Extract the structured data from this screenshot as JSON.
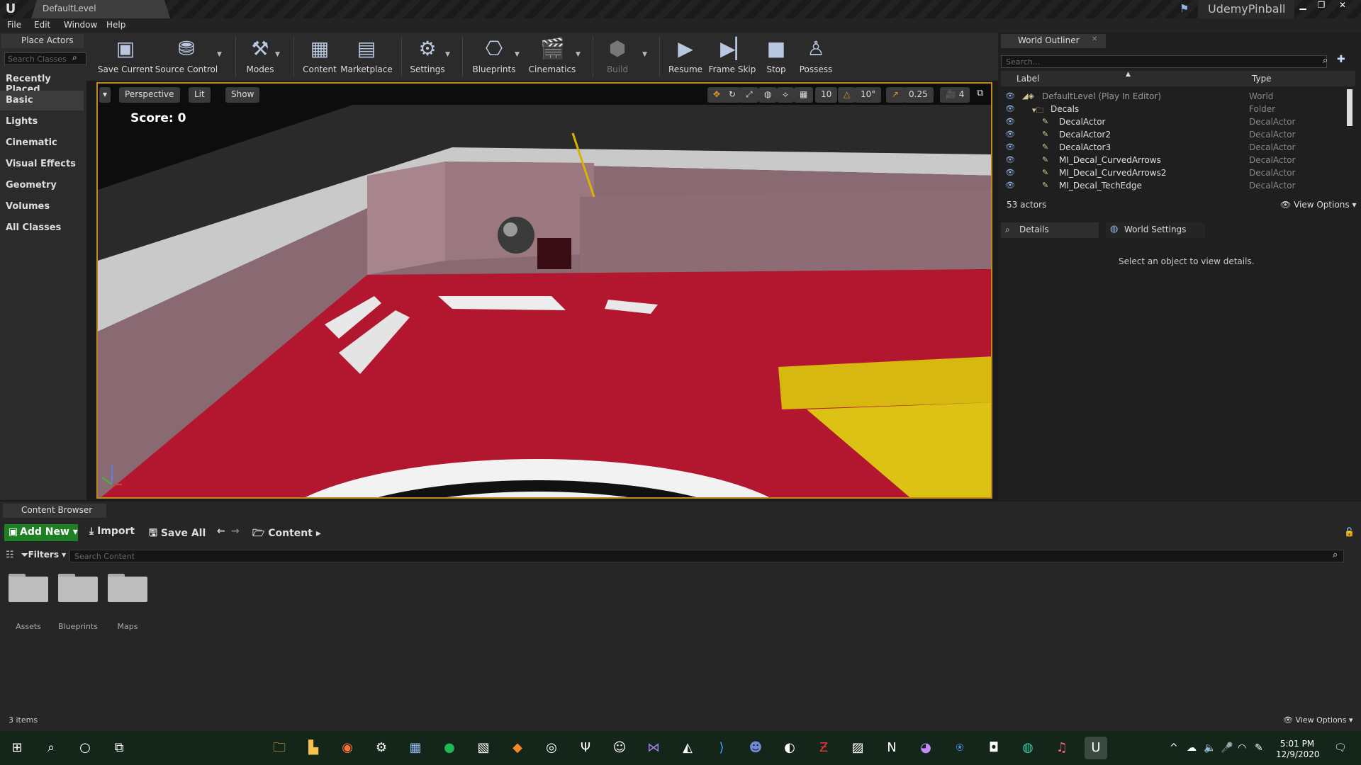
{
  "window": {
    "tab_title": "DefaultLevel",
    "project_name": "UdemyPinball"
  },
  "menu": [
    "File",
    "Edit",
    "Window",
    "Help"
  ],
  "place_actors": {
    "tab": "Place Actors",
    "search_placeholder": "Search Classes",
    "items": [
      "Recently Placed",
      "Basic",
      "Lights",
      "Cinematic",
      "Visual Effects",
      "Geometry",
      "Volumes",
      "All Classes"
    ],
    "selected": "Basic"
  },
  "toolbar": {
    "items": [
      {
        "label": "Save Current",
        "icon": "save-icon"
      },
      {
        "label": "Source Control",
        "icon": "source-control-icon"
      },
      {
        "label": "Modes",
        "icon": "modes-icon"
      },
      {
        "label": "Content",
        "icon": "content-icon"
      },
      {
        "label": "Marketplace",
        "icon": "marketplace-icon"
      },
      {
        "label": "Settings",
        "icon": "settings-icon"
      },
      {
        "label": "Blueprints",
        "icon": "blueprints-icon"
      },
      {
        "label": "Cinematics",
        "icon": "cinematics-icon"
      },
      {
        "label": "Build",
        "icon": "build-icon"
      },
      {
        "label": "Resume",
        "icon": "resume-icon"
      },
      {
        "label": "Frame Skip",
        "icon": "frame-skip-icon"
      },
      {
        "label": "Stop",
        "icon": "stop-icon"
      },
      {
        "label": "Possess",
        "icon": "possess-icon"
      }
    ]
  },
  "viewport": {
    "perspective": "Perspective",
    "lit": "Lit",
    "show": "Show",
    "grid_snap": "10",
    "rot_snap": "10°",
    "scale_snap": "0.25",
    "cam_speed": "4",
    "score": "Score: 0"
  },
  "world_outliner": {
    "tab": "World Outliner",
    "search_placeholder": "Search...",
    "col_label": "Label",
    "col_type": "Type",
    "rows": [
      {
        "label": "DefaultLevel (Play In Editor)",
        "type": "World",
        "indent": 0
      },
      {
        "label": "Decals",
        "type": "Folder",
        "indent": 1
      },
      {
        "label": "DecalActor",
        "type": "DecalActor",
        "indent": 2
      },
      {
        "label": "DecalActor2",
        "type": "DecalActor",
        "indent": 2
      },
      {
        "label": "DecalActor3",
        "type": "DecalActor",
        "indent": 2
      },
      {
        "label": "MI_Decal_CurvedArrows",
        "type": "DecalActor",
        "indent": 2
      },
      {
        "label": "MI_Decal_CurvedArrows2",
        "type": "DecalActor",
        "indent": 2
      },
      {
        "label": "MI_Decal_TechEdge",
        "type": "DecalActor",
        "indent": 2
      }
    ],
    "count": "53 actors",
    "view_options": "View Options"
  },
  "details": {
    "tab": "Details",
    "world_settings_tab": "World Settings",
    "message": "Select an object to view details."
  },
  "content_browser": {
    "tab": "Content Browser",
    "add_new": "Add New",
    "import": "Import",
    "save_all": "Save All",
    "path": "Content",
    "filters": "Filters",
    "search_placeholder": "Search Content",
    "folders": [
      "Assets",
      "Blueprints",
      "Maps"
    ],
    "count": "3 items",
    "view_options": "View Options"
  },
  "taskbar": {
    "time": "5:01 PM",
    "date": "12/9/2020"
  }
}
